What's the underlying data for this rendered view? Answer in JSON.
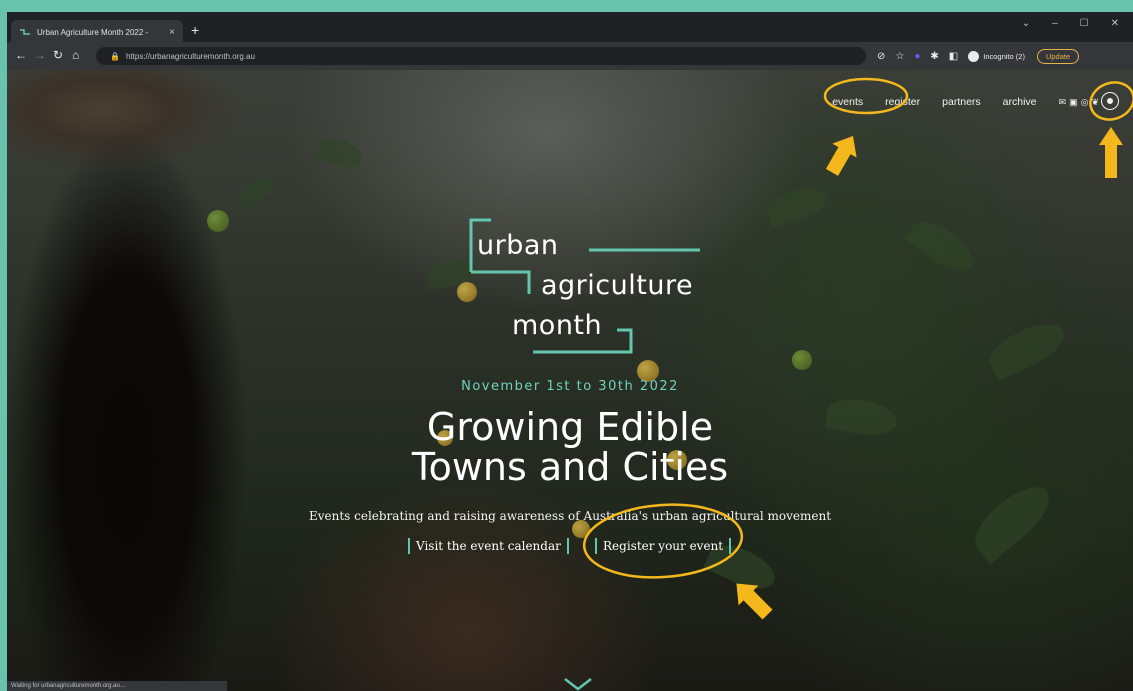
{
  "browser": {
    "tab_title": "Urban Agriculture Month 2022 -",
    "tab_close": "×",
    "new_tab": "+",
    "url": "https://urbanagriculturemonth.org.au",
    "incognito_label": "Incognito (2)",
    "update_label": "Update",
    "status_text": "Waiting for urbanagriculturemonth.org.au…",
    "window_controls": [
      "⌄",
      "–",
      "☐",
      "✕"
    ]
  },
  "site": {
    "nav": [
      "events",
      "register",
      "partners",
      "archive"
    ],
    "logo_words": [
      "urban",
      "agriculture",
      "month"
    ],
    "dates": "November 1st to 30th 2022",
    "headline_line1": "Growing Edible",
    "headline_line2": "Towns and Cities",
    "tagline": "Events celebrating and raising awareness of Australia's urban agricultural movement",
    "cta_calendar": "Visit the event calendar",
    "cta_register": "Register your event"
  },
  "colors": {
    "accent": "#63c6ae",
    "highlight": "#f5b81c",
    "border": "#69c2ac"
  }
}
